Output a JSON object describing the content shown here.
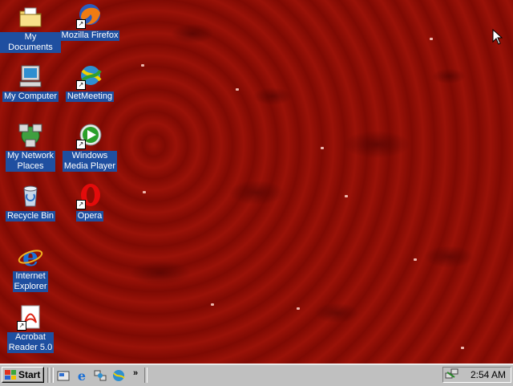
{
  "desktop": {
    "icons": [
      {
        "label": "My Documents",
        "icon": "folder-documents-icon"
      },
      {
        "label": "Mozilla Firefox",
        "icon": "firefox-icon"
      },
      {
        "label": "My Computer",
        "icon": "computer-icon"
      },
      {
        "label": "NetMeeting",
        "icon": "netmeeting-icon"
      },
      {
        "label": "My Network\nPlaces",
        "icon": "network-places-icon"
      },
      {
        "label": "Windows\nMedia Player",
        "icon": "media-player-icon"
      },
      {
        "label": "Recycle Bin",
        "icon": "recycle-bin-icon"
      },
      {
        "label": "Opera",
        "icon": "opera-icon"
      },
      {
        "label": "Internet\nExplorer",
        "icon": "internet-explorer-icon"
      },
      {
        "label": "Acrobat\nReader 5.0",
        "icon": "acrobat-reader-icon"
      }
    ]
  },
  "taskbar": {
    "start_label": "Start",
    "quick_launch": [
      "show-desktop-icon",
      "internet-explorer-icon",
      "network-icon",
      "netmeeting-icon"
    ],
    "more_label": "»",
    "clock": "2:54 AM"
  },
  "colors": {
    "desktop_background": "#8e0d05",
    "label_highlight": "#1f4fa0",
    "taskbar": "#c0c0c0"
  }
}
